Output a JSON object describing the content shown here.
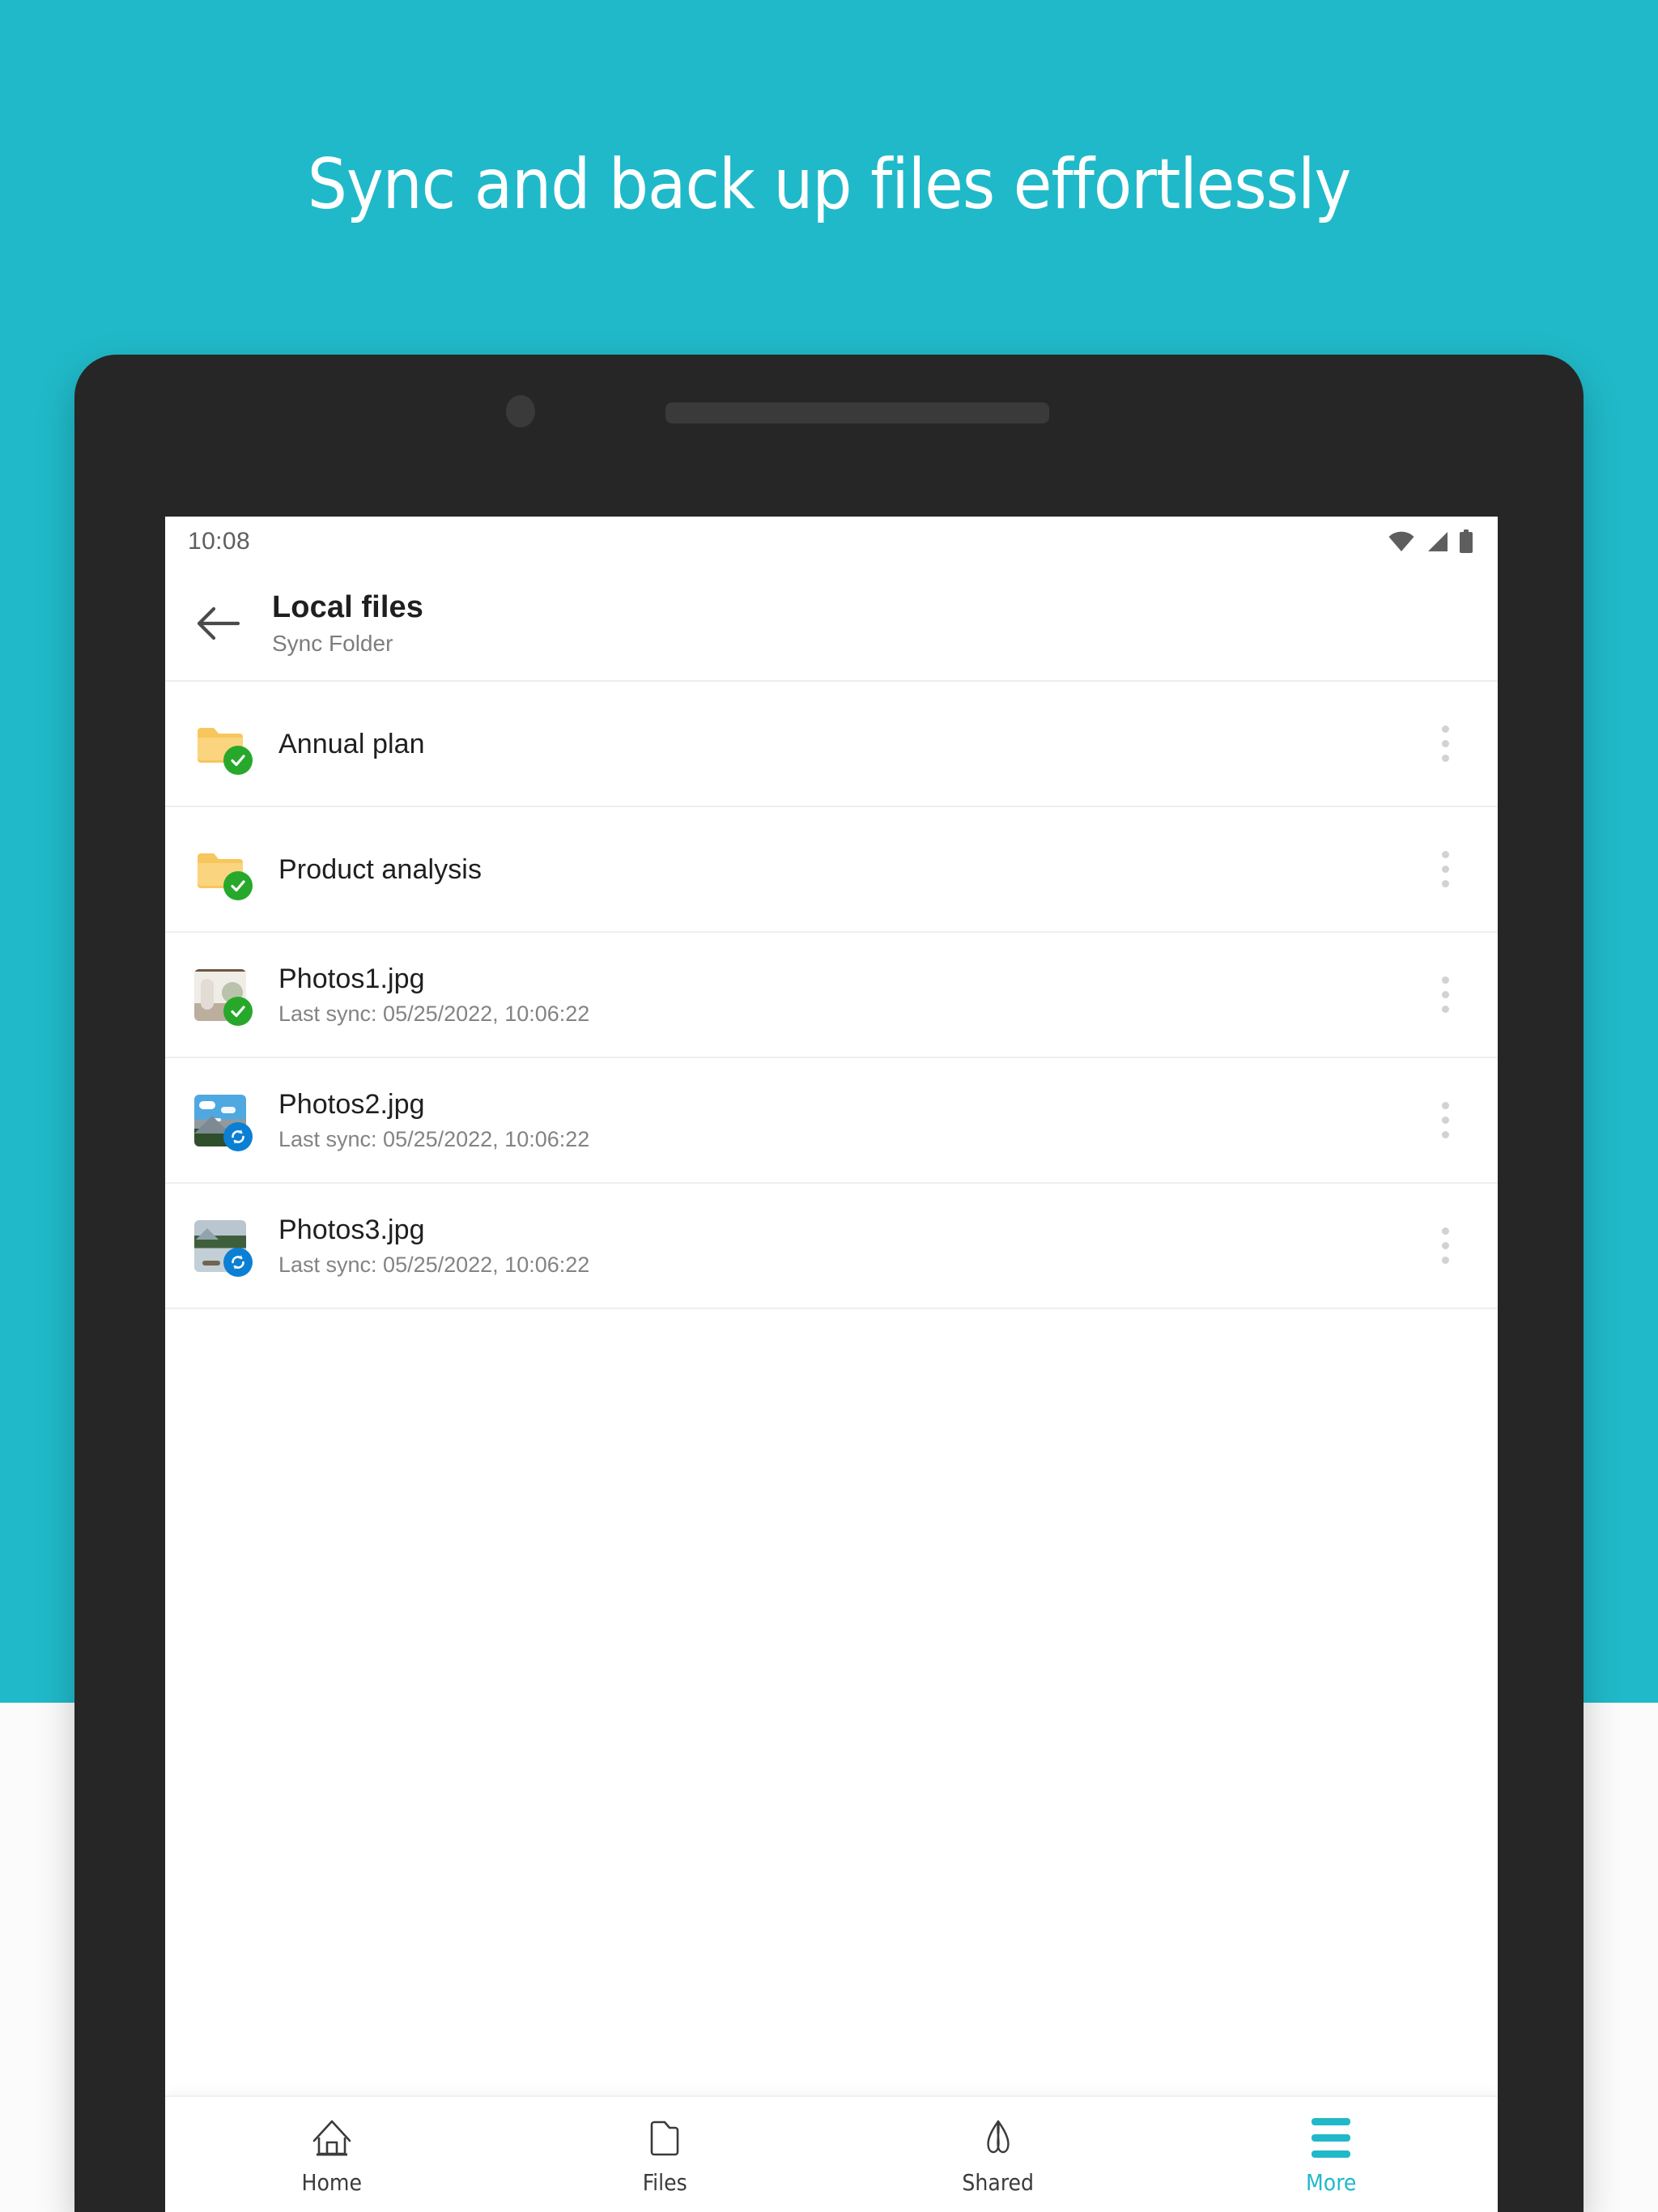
{
  "promo": {
    "headline": "Sync and back up files effortlessly",
    "background_color": "#20b9c9",
    "headline_color": "#ffffff"
  },
  "device": {
    "camera_icon": "front-camera-dot",
    "speaker_icon": "earpiece-speaker-grille"
  },
  "status_bar": {
    "time": "10:08",
    "icons": [
      "wifi-icon",
      "cellular-signal-icon",
      "battery-icon"
    ]
  },
  "app_bar": {
    "back_icon": "arrow-left-icon",
    "title": "Local files",
    "subtitle": "Sync Folder"
  },
  "file_list": {
    "rows": [
      {
        "name": "Annual plan",
        "subtitle": "",
        "icon": "folder-icon",
        "thumb_class": "",
        "badge": "check-badge",
        "badge_class": "ok",
        "overflow_icon": "more-vertical-icon"
      },
      {
        "name": "Product analysis",
        "subtitle": "",
        "icon": "folder-icon",
        "thumb_class": "",
        "badge": "check-badge",
        "badge_class": "ok",
        "overflow_icon": "more-vertical-icon"
      },
      {
        "name": "Photos1.jpg",
        "subtitle": "Last sync: 05/25/2022, 10:06:22",
        "icon": "image-thumbnail",
        "thumb_class": "thumb-photo1",
        "badge": "check-badge",
        "badge_class": "ok",
        "overflow_icon": "more-vertical-icon"
      },
      {
        "name": "Photos2.jpg",
        "subtitle": "Last sync: 05/25/2022, 10:06:22",
        "icon": "image-thumbnail",
        "thumb_class": "thumb-photo2",
        "badge": "sync-badge",
        "badge_class": "sync",
        "overflow_icon": "more-vertical-icon"
      },
      {
        "name": "Photos3.jpg",
        "subtitle": "Last sync: 05/25/2022, 10:06:22",
        "icon": "image-thumbnail",
        "thumb_class": "thumb-photo3",
        "badge": "sync-badge",
        "badge_class": "sync",
        "overflow_icon": "more-vertical-icon"
      }
    ]
  },
  "bottom_nav": {
    "active_color": "#20b9c9",
    "inactive_color": "#3b3b3b",
    "items": [
      {
        "label": "Home",
        "icon": "home-icon",
        "active": false
      },
      {
        "label": "Files",
        "icon": "folder-icon",
        "active": false
      },
      {
        "label": "Shared",
        "icon": "shared-icon",
        "active": false
      },
      {
        "label": "More",
        "icon": "menu-icon",
        "active": true
      }
    ]
  }
}
